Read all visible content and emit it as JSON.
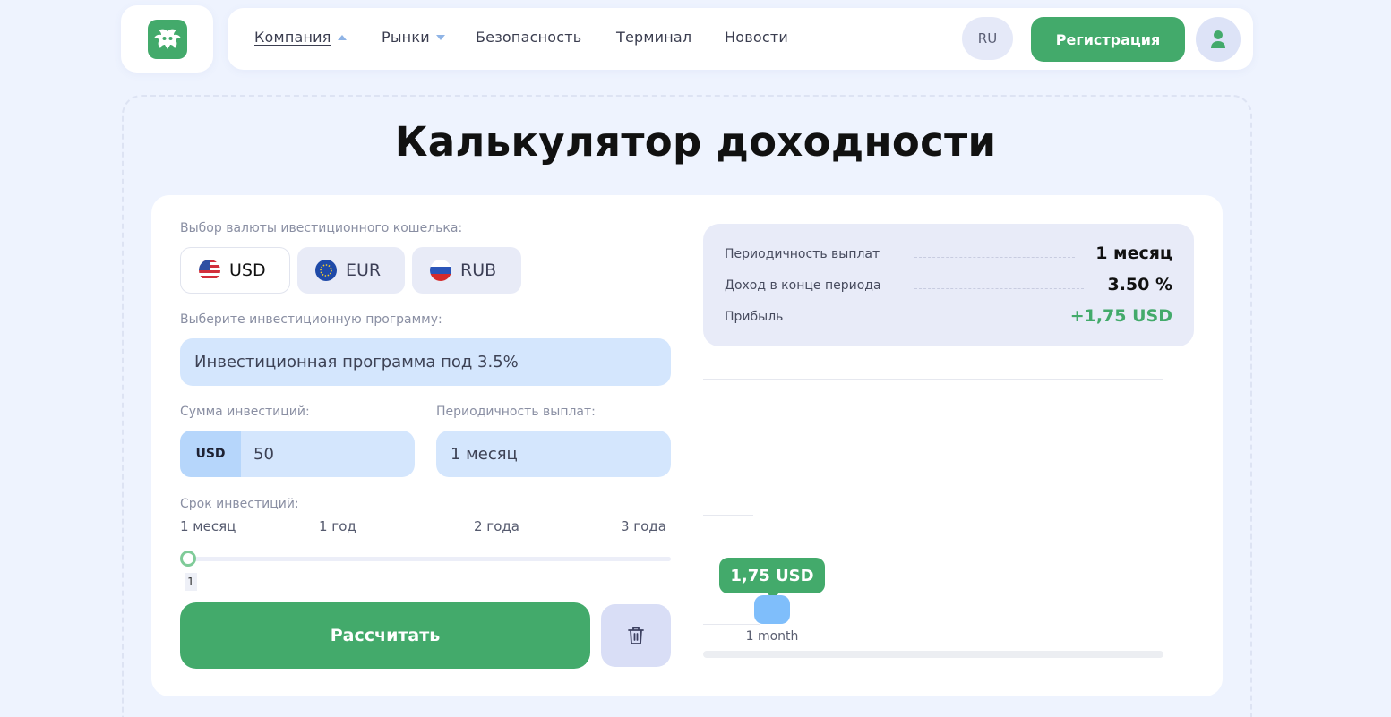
{
  "header": {
    "nav": [
      {
        "label": "Компания",
        "has_caret": true,
        "active": true
      },
      {
        "label": "Рынки",
        "has_caret": true,
        "active": false
      },
      {
        "label": "Безопасность",
        "has_caret": false,
        "active": false
      },
      {
        "label": "Терминал",
        "has_caret": false,
        "active": false
      },
      {
        "label": "Новости",
        "has_caret": false,
        "active": false
      }
    ],
    "lang": "RU",
    "register_label": "Регистрация",
    "brand_color": "#43aa6b"
  },
  "title": "Калькулятор доходности",
  "form": {
    "currency_label": "Выбор валюты ивестиционного кошелька:",
    "currencies": [
      {
        "code": "USD",
        "selected": true,
        "icon": "us-flag-icon"
      },
      {
        "code": "EUR",
        "selected": false,
        "icon": "eu-flag-icon"
      },
      {
        "code": "RUB",
        "selected": false,
        "icon": "ru-flag-icon"
      }
    ],
    "program_label": "Выберите инвестиционную программу:",
    "program_value": "Инвестиционная программа под 3.5%",
    "amount_label": "Сумма инвестиций:",
    "amount_currency": "USD",
    "amount_value": "50",
    "period_label": "Периодичность выплат:",
    "period_value": "1 месяц",
    "term_label": "Срок инвестиций:",
    "term_ticks": [
      "1 месяц",
      "1 год",
      "2 года",
      "3 года"
    ],
    "term_value": "1",
    "calculate_label": "Рассчитать",
    "clear_icon": "trash-icon"
  },
  "summary": {
    "rows": [
      {
        "label": "Периодичность выплат",
        "value": "1 месяц",
        "green": false
      },
      {
        "label": "Доход в конце периода",
        "value": "3.50 %",
        "green": false
      },
      {
        "label": "Прибыль",
        "value": "+1,75 USD",
        "green": true
      }
    ]
  },
  "chart_data": {
    "type": "bar",
    "categories": [
      "1 month"
    ],
    "series": [
      {
        "values": [
          1.75
        ]
      }
    ],
    "data_labels": [
      "1,75 USD"
    ],
    "bar_color": "#7fbefb",
    "label_color": "#43aa6b"
  }
}
